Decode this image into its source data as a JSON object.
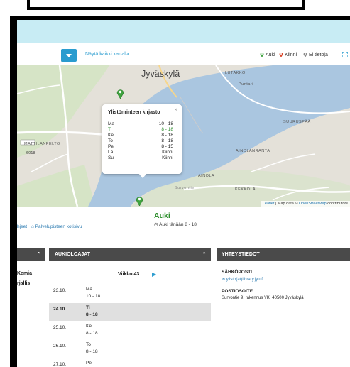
{
  "toolbar": {
    "show_all_label": "Näytä kaikki kartalla",
    "legend": [
      {
        "label": "Auki",
        "color": "#3fa33f"
      },
      {
        "label": "Kiinni",
        "color": "#d9462b"
      },
      {
        "label": "Ei tietoja",
        "color": "#8a8a8a"
      }
    ]
  },
  "map": {
    "city_label": "Jyväskylä",
    "place_labels": [
      "LUTAKKO",
      "Puntari",
      "MATTILANPELTO",
      "AINOLANRANTA",
      "SUURUSPÄÄ",
      "AINOLA",
      "KEKKOLA",
      "Survontie"
    ],
    "road_number": "6018",
    "attribution": {
      "leaflet": "Leaflet",
      "sep": " | Map data © ",
      "osm": "OpenStreetMap",
      "rest": " contributors"
    },
    "popup": {
      "title": "Ylistönrinteen kirjasto",
      "close": "×",
      "hours": [
        {
          "day": "Ma",
          "time": "10 - 18"
        },
        {
          "day": "Ti",
          "time": "8 - 18",
          "today": true
        },
        {
          "day": "Ke",
          "time": "8 - 18"
        },
        {
          "day": "To",
          "time": "8 - 18"
        },
        {
          "day": "Pe",
          "time": "8 - 15"
        },
        {
          "day": "La",
          "time": "Kiinni"
        },
        {
          "day": "Su",
          "time": "Kiinni"
        }
      ]
    }
  },
  "status": {
    "title": "Auki",
    "today": "Auki tänään 8 - 18",
    "links": {
      "instructions": "hjeet",
      "homepage": "Palvelupisteen kotisivu"
    }
  },
  "left_column": {
    "lines": [
      "Kemia",
      "rjallis"
    ]
  },
  "opening_hours": {
    "header": "AUKIOLOAJAT",
    "week": "Viikko 43",
    "rows": [
      {
        "date": "23.10.",
        "day": "Ma",
        "hours": "10 - 18"
      },
      {
        "date": "24.10.",
        "day": "Ti",
        "hours": "8 - 18",
        "today": true
      },
      {
        "date": "25.10.",
        "day": "Ke",
        "hours": "8 - 18"
      },
      {
        "date": "26.10.",
        "day": "To",
        "hours": "8 - 18"
      },
      {
        "date": "27.10.",
        "day": "Pe",
        "hours": ""
      }
    ]
  },
  "contact": {
    "header": "YHTEYSTIEDOT",
    "email_label": "SÄHKÖPOSTI",
    "email": "ylisto(at)library.jyu.fi",
    "address_label": "POSTIOSOITE",
    "address": "Survontie 9, rakennus YK, 40500 Jyväskylä"
  },
  "icons": {
    "dropdown": "chevron-down",
    "home": "⌂",
    "clock": "◷",
    "mail": "✉",
    "play": "▶",
    "collapse": "⌃"
  }
}
